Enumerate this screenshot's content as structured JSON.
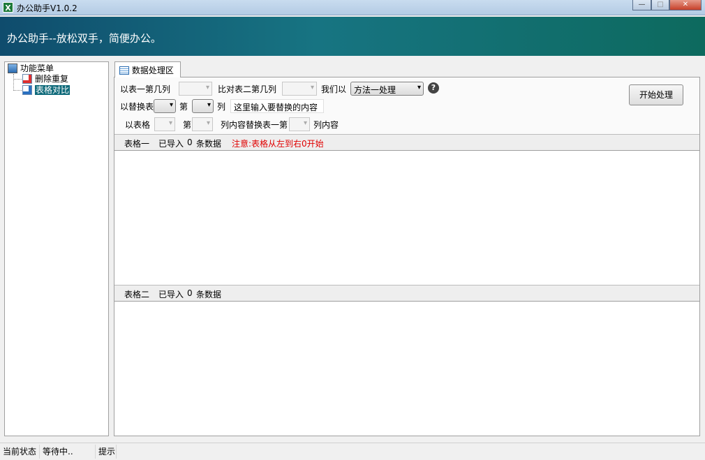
{
  "window": {
    "title": "办公助手V1.0.2",
    "app_icon": "X"
  },
  "banner": {
    "text": "办公助手--放松双手，简便办公。"
  },
  "tree": {
    "root": "功能菜单",
    "items": [
      {
        "label": "删除重复"
      },
      {
        "label": "表格对比",
        "selected": true
      }
    ]
  },
  "tab": {
    "label": "数据处理区"
  },
  "controls": {
    "row1": {
      "label1": "以表一第几列",
      "label2": "比对表二第几列",
      "label3": "我们以",
      "method_value": "方法一处理",
      "help": "?"
    },
    "row2": {
      "label1": "以替换表",
      "label2": "第",
      "label3": "列",
      "replace_input": "这里输入要替换的内容"
    },
    "row3": {
      "label1": "以表格",
      "label2": "第",
      "label3": "列内容替换表一第",
      "label4": "列内容"
    },
    "start_button": "开始处理"
  },
  "table1": {
    "name": "表格一",
    "imported": "已导入",
    "count": "0",
    "unit": "条数据",
    "notice": "注意:表格从左到右0开始",
    "notice_color": "#e00000"
  },
  "table2": {
    "name": "表格二",
    "imported": "已导入",
    "count": "0",
    "unit": "条数据"
  },
  "status": {
    "label": "当前状态",
    "value": "等待中..",
    "hint": "提示"
  }
}
